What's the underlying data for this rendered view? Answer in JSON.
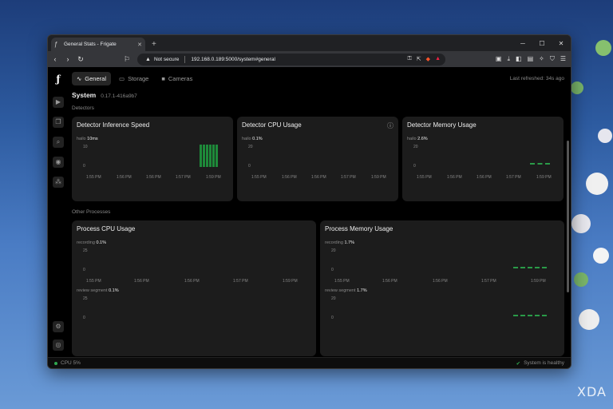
{
  "browser": {
    "tab_title": "General Stats - Frigate",
    "security": "Not secure",
    "url": "192.168.0.189:5000/system#general"
  },
  "nav": {
    "tabs": [
      {
        "label": "General"
      },
      {
        "label": "Storage"
      },
      {
        "label": "Cameras"
      }
    ],
    "last_refreshed": "Last refreshed: 34s ago"
  },
  "system": {
    "title": "System",
    "version": "0.17.1-416a9b7"
  },
  "sections": {
    "detectors": "Detectors",
    "other": "Other Processes"
  },
  "cards": {
    "inference": {
      "title": "Detector Inference Speed",
      "series": "hailo",
      "value": "10ms",
      "ymax": "10",
      "ymin": "0"
    },
    "cpu": {
      "title": "Detector CPU Usage",
      "series": "hailo",
      "value": "0.1%",
      "ymax": "20",
      "ymin": "0"
    },
    "memory": {
      "title": "Detector Memory Usage",
      "series": "hailo",
      "value": "2.6%",
      "ymax": "20",
      "ymin": "0"
    },
    "proc_cpu": {
      "title": "Process CPU Usage",
      "s1": "recording",
      "v1": "0.1%",
      "y1max": "25",
      "y1min": "0",
      "s2": "review segment",
      "v2": "0.1%",
      "y2max": "25",
      "y2min": "0"
    },
    "proc_mem": {
      "title": "Process Memory Usage",
      "s1": "recording",
      "v1": "1.7%",
      "y1max": "20",
      "y1min": "0",
      "s2": "review segment",
      "v2": "1.7%",
      "y2max": "20",
      "y2min": "0"
    }
  },
  "xticks": [
    "1:55 PM",
    "1:56 PM",
    "1:56 PM",
    "1:57 PM",
    "1:59 PM"
  ],
  "xticks_trunc": [
    "1:55 PM",
    "1:56 PM",
    "1:56 PM",
    "1:57 PM",
    "1:59 PM"
  ],
  "status": {
    "cpu": "CPU 5%",
    "health": "System is healthy"
  },
  "watermark": "XDA",
  "colors": {
    "accent_green": "#1e8a3a",
    "background": "#000000"
  }
}
